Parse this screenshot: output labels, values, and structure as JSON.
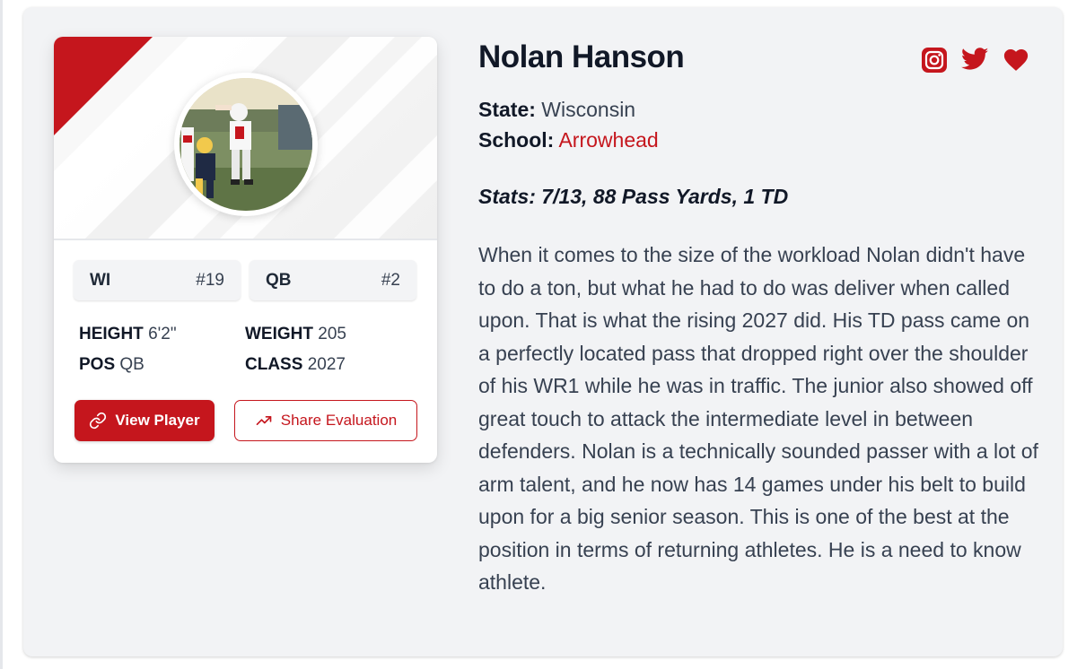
{
  "player": {
    "name": "Nolan Hanson",
    "state_label": "State:",
    "state": "Wisconsin",
    "school_label": "School:",
    "school": "Arrowhead",
    "stats": "Stats: 7/13, 88 Pass Yards, 1 TD",
    "bio": "When it comes to the size of the workload Nolan didn't have to do a ton, but what he had to do was deliver when called upon. That is what the rising 2027 did. His TD pass came on a perfectly located pass that dropped right over the shoulder of his WR1 while he was in traffic. The junior also showed off great touch to attack the intermediate level in between defenders. Nolan is a technically sounded passer with a lot of arm talent, and he now has 14 games under his belt to build upon for a big senior season. This is one of the best at the position in terms of returning athletes. He is a need to know athlete."
  },
  "card": {
    "chips": [
      {
        "label": "WI",
        "number": "#19"
      },
      {
        "label": "QB",
        "number": "#2"
      }
    ],
    "attributes": {
      "height_label": "HEIGHT",
      "height": "6'2\"",
      "weight_label": "WEIGHT",
      "weight": "205",
      "pos_label": "POS",
      "pos": "QB",
      "class_label": "CLASS",
      "class": "2027"
    },
    "view_button": "View Player",
    "share_button": "Share Evaluation"
  },
  "social_icons": [
    "instagram-icon",
    "twitter-icon",
    "heart-icon"
  ],
  "colors": {
    "accent": "#c5161d",
    "panel_bg": "#f2f3f5",
    "text_dark": "#111827",
    "text_body": "#374151"
  }
}
